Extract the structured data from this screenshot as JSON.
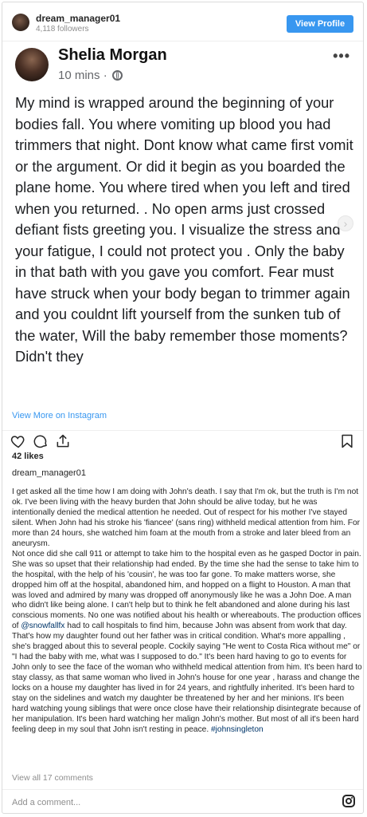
{
  "header": {
    "username": "dream_manager01",
    "followers": "4,118 followers",
    "view_profile_label": "View Profile"
  },
  "post": {
    "author_name": "Shelia Morgan",
    "time": "10 mins ·",
    "body": "My mind is wrapped around the beginning of your bodies  fall.  You where vomiting up blood you had  trimmers  that night. Dont know what came first vomit or the argument. Or did it begin as you boarded the plane home.  You where tired when you left and tired when you returned. .   No open arms just crossed defiant fists greeting   you.  I visualize the stress and  your  fatigue,  I could not protect you  .  Only the baby in that bath with you gave you comfort.  Fear must have struck when your body began to trimmer again and you couldnt  lift yourself from the sunken tub of the water,  Will the baby remember those moments?    Didn't they",
    "more_icon": "more-dots-icon",
    "privacy_icon": "globe-icon",
    "next_icon": "chevron-right-icon"
  },
  "view_more_label": "View More on Instagram",
  "actions": {
    "icons": [
      "heart-icon",
      "comment-icon",
      "share-icon",
      "bookmark-icon"
    ]
  },
  "likes": "42 likes",
  "caption": {
    "username": "dream_manager01",
    "text_1": "I get asked all the time how I am doing with John's death. I say that I'm ok, but the truth is I'm not ok. I've been living with the heavy burden that John should be alive today, but he was intentionally denied the medical attention he needed. Out of respect for his mother I've stayed silent. When John had his stroke his 'fiancee' (sans ring) withheld medical attention from him. For more than 24 hours, she watched him foam at the mouth from a stroke and later bleed from an aneurysm.\nNot once did she call 911 or attempt to take him to the hospital even as he gasped Doctor in pain. She was so upset that their relationship had ended. By the time she had the sense to take him to the hospital, with the help of his 'cousin', he was too far gone. To make matters worse, she dropped him off at the hospital, abandoned him, and hopped on a flight to Houston. A man that was loved and admired by many was dropped off anonymously like he was a John Doe. A man who didn't like being alone. I can't help but to think he felt abandoned and alone during his last conscious moments. No one was notified about his health or whereabouts. The production offices of ",
    "mention": "@snowfallfx",
    "text_2": " had to call hospitals to find him, because John was absent from work that day. That's how my daughter found out her father was in critical condition. What's more appalling , she's bragged about this to several people. Cockily saying \"He went to Costa Rica without me\" or \"I had the baby with me, what was I supposed to do.\" It's been hard having to go to events for John only to see the face of the woman who withheld medical attention from him. It's been hard to stay classy, as that same woman who lived in John's house for one year , harass and change the locks on a house my daughter has lived in for 24 years, and rightfully inherited. It's been hard to stay on the sidelines and watch my daughter be threatened by her and her minions. It's been hard watching young siblings that were once close have their relationship disintegrate because of her manipulation. It's been hard watching her malign John's mother. But most of all it's been hard feeling deep in my soul that John isn't resting in peace. ",
    "hashtag": "#johnsingleton"
  },
  "view_all_comments": "View all 17 comments",
  "add_comment_placeholder": "Add a comment...",
  "colors": {
    "accent": "#3897f0",
    "text": "#262626",
    "muted": "#8e8e8e",
    "link": "#003569"
  }
}
